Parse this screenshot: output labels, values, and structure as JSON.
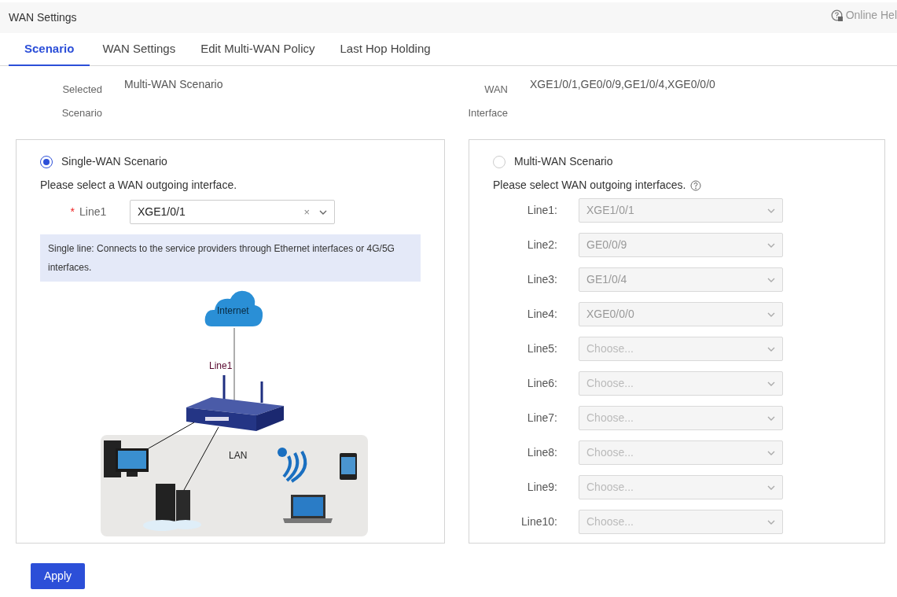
{
  "header": {
    "title": "WAN Settings",
    "help_link": "Online Hel"
  },
  "tabs": [
    {
      "label": "Scenario",
      "selected": true
    },
    {
      "label": "WAN Settings",
      "selected": false
    },
    {
      "label": "Edit Multi-WAN Policy",
      "selected": false
    },
    {
      "label": "Last Hop Holding",
      "selected": false
    }
  ],
  "summary": [
    {
      "label": "Selected Scenario",
      "value": "Multi-WAN Scenario"
    },
    {
      "label": "WAN Interface",
      "value": "XGE1/0/1,GE0/0/9,GE1/0/4,XGE0/0/0"
    }
  ],
  "scenarios": [
    {
      "kind": "single",
      "label": "Single-WAN Scenario",
      "selected": true,
      "prompt": "Please select a WAN outgoing interface.",
      "lines": [
        {
          "required_mark": "*",
          "label": "Line1",
          "value": "XGE1/0/1",
          "clear_mark": "×"
        }
      ],
      "note": "Single line: Connects to the service providers through Ethernet interfaces or 4G/5G interfaces.",
      "diagram": {
        "cloud_label": "Internet",
        "link_label": "Line1",
        "lan_label": "LAN"
      }
    },
    {
      "kind": "multi",
      "label": "Multi-WAN Scenario",
      "selected": false,
      "prompt": "Please select WAN outgoing interfaces.",
      "lines": [
        {
          "label": "Line1:",
          "value": "XGE1/0/1"
        },
        {
          "label": "Line2:",
          "value": "GE0/0/9"
        },
        {
          "label": "Line3:",
          "value": "GE1/0/4"
        },
        {
          "label": "Line4:",
          "value": "XGE0/0/0"
        },
        {
          "label": "Line5:",
          "placeholder": "Choose..."
        },
        {
          "label": "Line6:",
          "placeholder": "Choose..."
        },
        {
          "label": "Line7:",
          "placeholder": "Choose..."
        },
        {
          "label": "Line8:",
          "placeholder": "Choose..."
        },
        {
          "label": "Line9:",
          "placeholder": "Choose..."
        },
        {
          "label": "Line10:",
          "placeholder": "Choose..."
        }
      ]
    }
  ],
  "buttons": [
    "Apply"
  ]
}
